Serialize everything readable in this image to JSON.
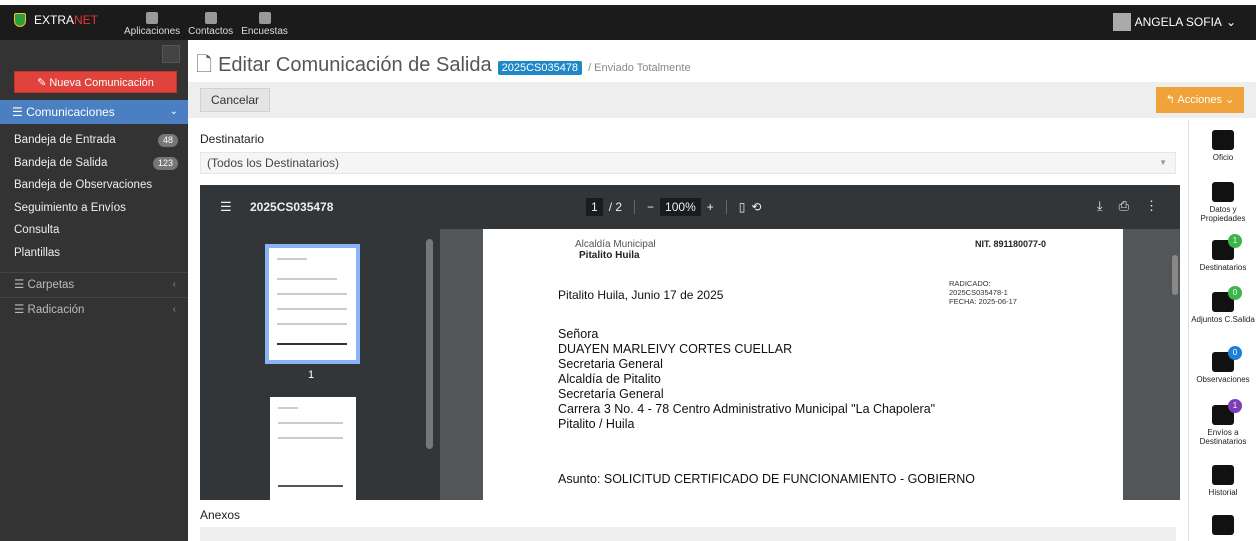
{
  "topbar": {
    "brand_prefix": "EXTRA",
    "brand_suffix": "NET",
    "nav": [
      {
        "label": "Aplicaciones",
        "icon": "pencil-icon"
      },
      {
        "label": "Contactos",
        "icon": "contacts-icon"
      },
      {
        "label": "Encuestas",
        "icon": "document-icon"
      }
    ],
    "user": "ANGELA SOFIA"
  },
  "sidebar": {
    "new_button": "Nueva Comunicación",
    "section": "Comunicaciones",
    "items": [
      {
        "label": "Bandeja de Entrada",
        "badge": "48"
      },
      {
        "label": "Bandeja de Salida",
        "badge": "123"
      },
      {
        "label": "Bandeja de Observaciones",
        "badge": ""
      },
      {
        "label": "Seguimiento a Envíos",
        "badge": ""
      },
      {
        "label": "Consulta",
        "badge": ""
      },
      {
        "label": "Plantillas",
        "badge": ""
      }
    ],
    "groups": [
      "Carpetas",
      "Radicación"
    ]
  },
  "main": {
    "title": "Editar Comunicación de Salida",
    "code": "2025CS035478",
    "status": "/ Enviado Totalmente",
    "cancel": "Cancelar",
    "actions": "Acciones",
    "dest_label": "Destinatario",
    "dest_value": "(Todos los Destinatarios)",
    "anexos": "Anexos"
  },
  "viewer": {
    "file": "2025CS035478",
    "page": "1",
    "pages": "/ 2",
    "zoom": "100%",
    "thumb_page": "1"
  },
  "letter": {
    "muni": "Alcaldía Municipal",
    "city": "Pitalito Huila",
    "nit": "NIT. 891180077-0",
    "rad_label": "RADICADO:",
    "rad_code": "2025CS035478-1",
    "rad_date": "FECHA: 2025-06-17",
    "date_line": "Pitalito Huila, Junio 17 de 2025",
    "addr": [
      "Señora",
      "DUAYEN MARLEIVY CORTES CUELLAR",
      "Secretaria General",
      "Alcaldía de Pitalito",
      "Secretaría General",
      "Carrera 3 No. 4 - 78 Centro Administrativo Municipal \"La Chapolera\"",
      "Pitalito / Huila"
    ],
    "asunto": "Asunto: SOLICITUD CERTIFICADO DE FUNCIONAMIENTO - GOBIERNO"
  },
  "rightbar": [
    {
      "label": "Oficio",
      "icon": "edit-icon",
      "badge": ""
    },
    {
      "label": "Datos y Propiedades",
      "icon": "grid-icon",
      "badge": ""
    },
    {
      "label": "Destinatarios",
      "icon": "user-icon",
      "badge": "1"
    },
    {
      "label": "Adjuntos C.Salida",
      "icon": "paperclip-icon",
      "badge": "0"
    },
    {
      "label": "Observaciones",
      "icon": "comments-icon",
      "badge": "0"
    },
    {
      "label": "Envíos a Destinatarios",
      "icon": "truck-icon",
      "badge": "1"
    },
    {
      "label": "Historial",
      "icon": "clock-icon",
      "badge": ""
    }
  ]
}
